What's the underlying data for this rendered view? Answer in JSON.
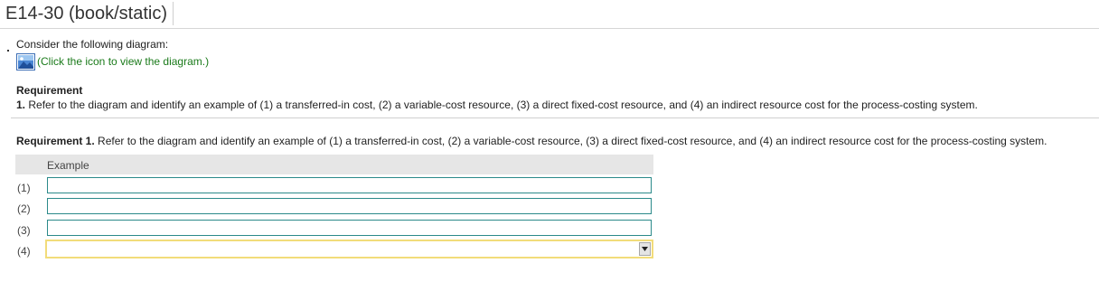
{
  "header": {
    "title": "E14-30 (book/static)"
  },
  "intro": {
    "consider_text": "Consider the following diagram:",
    "diagram_link_text": "(Click the icon to view the diagram.)",
    "diagram_icon": "image-icon"
  },
  "requirement": {
    "heading": "Requirement",
    "number": "1.",
    "text": "Refer to the diagram and identify an example of (1) a transferred-in cost, (2) a variable-cost resource, (3) a direct fixed-cost resource, and (4) an indirect resource cost for the process-costing system."
  },
  "requirement1": {
    "label": "Requirement 1.",
    "text": "Refer to the diagram and identify an example of (1) a transferred-in cost, (2) a variable-cost resource, (3) a direct fixed-cost resource, and (4) an indirect resource cost for the process-costing system."
  },
  "answer_table": {
    "column_header": "Example",
    "rows": [
      {
        "label": "(1)",
        "value": ""
      },
      {
        "label": "(2)",
        "value": ""
      },
      {
        "label": "(3)",
        "value": ""
      },
      {
        "label": "(4)",
        "value": ""
      }
    ]
  },
  "colors": {
    "link_green": "#1a7a1a",
    "input_border": "#2b8a8a",
    "select_highlight": "#f2dc7a",
    "header_bg": "#e6e6e6"
  }
}
